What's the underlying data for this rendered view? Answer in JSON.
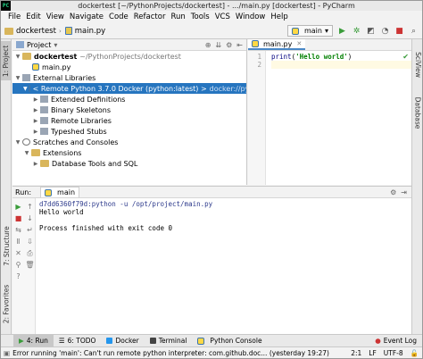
{
  "app": {
    "logo_text": "PC",
    "title": "dockertest [~/PythonProjects/dockertest] - .../main.py [dockertest] - PyCharm"
  },
  "menu": [
    "File",
    "Edit",
    "View",
    "Navigate",
    "Code",
    "Refactor",
    "Run",
    "Tools",
    "VCS",
    "Window",
    "Help"
  ],
  "navbar": {
    "crumb_project": "dockertest",
    "crumb_file": "main.py",
    "run_config": "main"
  },
  "left_stripe": {
    "project_tab": "1: Project",
    "structure_tab": "7: Structure",
    "favorites_tab": "2: Favorites"
  },
  "right_stripe": {
    "sciview_tab": "SciView",
    "database_tab": "Database"
  },
  "project_panel": {
    "title": "Project",
    "tree": [
      {
        "label": "dockertest",
        "hint": "~/PythonProjects/dockertest"
      },
      {
        "label": "main.py"
      },
      {
        "label": "External Libraries"
      },
      {
        "label": "< Remote Python 3.7.0 Docker (python:latest) >",
        "hint": "docker://pyth"
      },
      {
        "label": "Extended Definitions"
      },
      {
        "label": "Binary Skeletons"
      },
      {
        "label": "Remote Libraries"
      },
      {
        "label": "Typeshed Stubs"
      },
      {
        "label": "Scratches and Consoles"
      },
      {
        "label": "Extensions"
      },
      {
        "label": "Database Tools and SQL"
      }
    ]
  },
  "editor": {
    "tab": "main.py",
    "line_numbers": [
      "1",
      "2"
    ],
    "code_fn": "print",
    "code_open": "(",
    "code_str": "'Hello world'",
    "code_close": ")"
  },
  "run_panel": {
    "title": "Run:",
    "tab": "main",
    "console": {
      "command": "d7dd6360f79d:python -u /opt/project/main.py",
      "output": "Hello world",
      "exit": "Process finished with exit code 0"
    }
  },
  "bottom_tools": {
    "run": "4: Run",
    "todo": "6: TODO",
    "docker": "Docker",
    "terminal": "Terminal",
    "python_console": "Python Console",
    "event_log": "Event Log"
  },
  "status": {
    "message": "Error running 'main': Can't run remote python interpreter: com.github.doc... (yesterday 19:27)",
    "position": "2:1",
    "line_sep": "LF",
    "encoding": "UTF-8"
  },
  "colors": {
    "selection": "#2675bf",
    "run_green": "#3a9c3a",
    "string_green": "#008000"
  }
}
